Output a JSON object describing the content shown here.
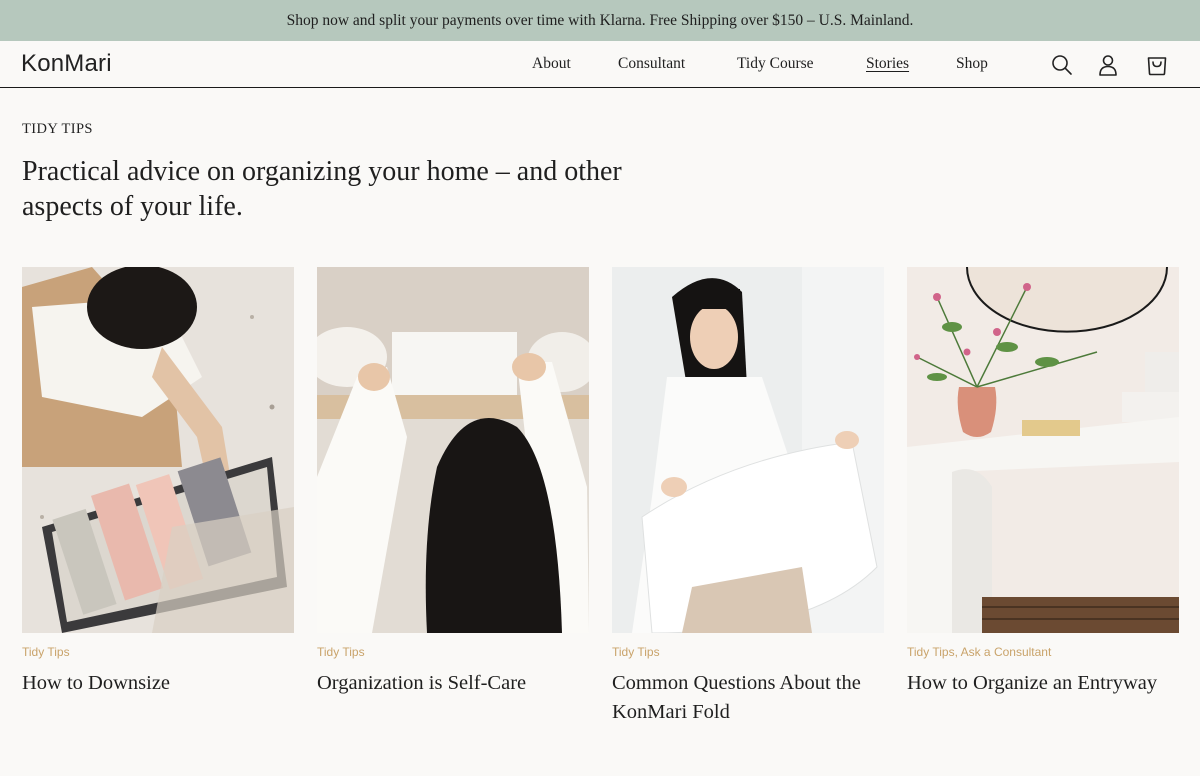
{
  "promo": {
    "text": "Shop now and split your payments over time with Klarna. Free Shipping over $150 – U.S. Mainland."
  },
  "header": {
    "logo": "KonMari",
    "nav": [
      {
        "label": "About",
        "active": false
      },
      {
        "label": "Consultant",
        "active": false
      },
      {
        "label": "Tidy Course",
        "active": false
      },
      {
        "label": "Stories",
        "active": true
      },
      {
        "label": "Shop",
        "active": false
      }
    ],
    "icons": [
      "search-icon",
      "account-icon",
      "cart-icon"
    ]
  },
  "page": {
    "eyebrow": "TIDY TIPS",
    "headline": "Practical advice on organizing your home – and other aspects of your life."
  },
  "colors": {
    "promo_bg": "#b6c8bd",
    "page_bg": "#faf9f7",
    "category": "#c9a36a",
    "text": "#1f1f1f"
  },
  "cards": [
    {
      "category": "Tidy Tips",
      "category2": "",
      "title": "How to Downsize"
    },
    {
      "category": "Tidy Tips",
      "category2": "",
      "title": "Organization is Self-Care"
    },
    {
      "category": "Tidy Tips",
      "category2": "",
      "title": "Common Questions About the KonMari Fold"
    },
    {
      "category": "Tidy Tips",
      "category2": "Ask a Consultant",
      "title": "How to Organize an Entryway"
    }
  ]
}
